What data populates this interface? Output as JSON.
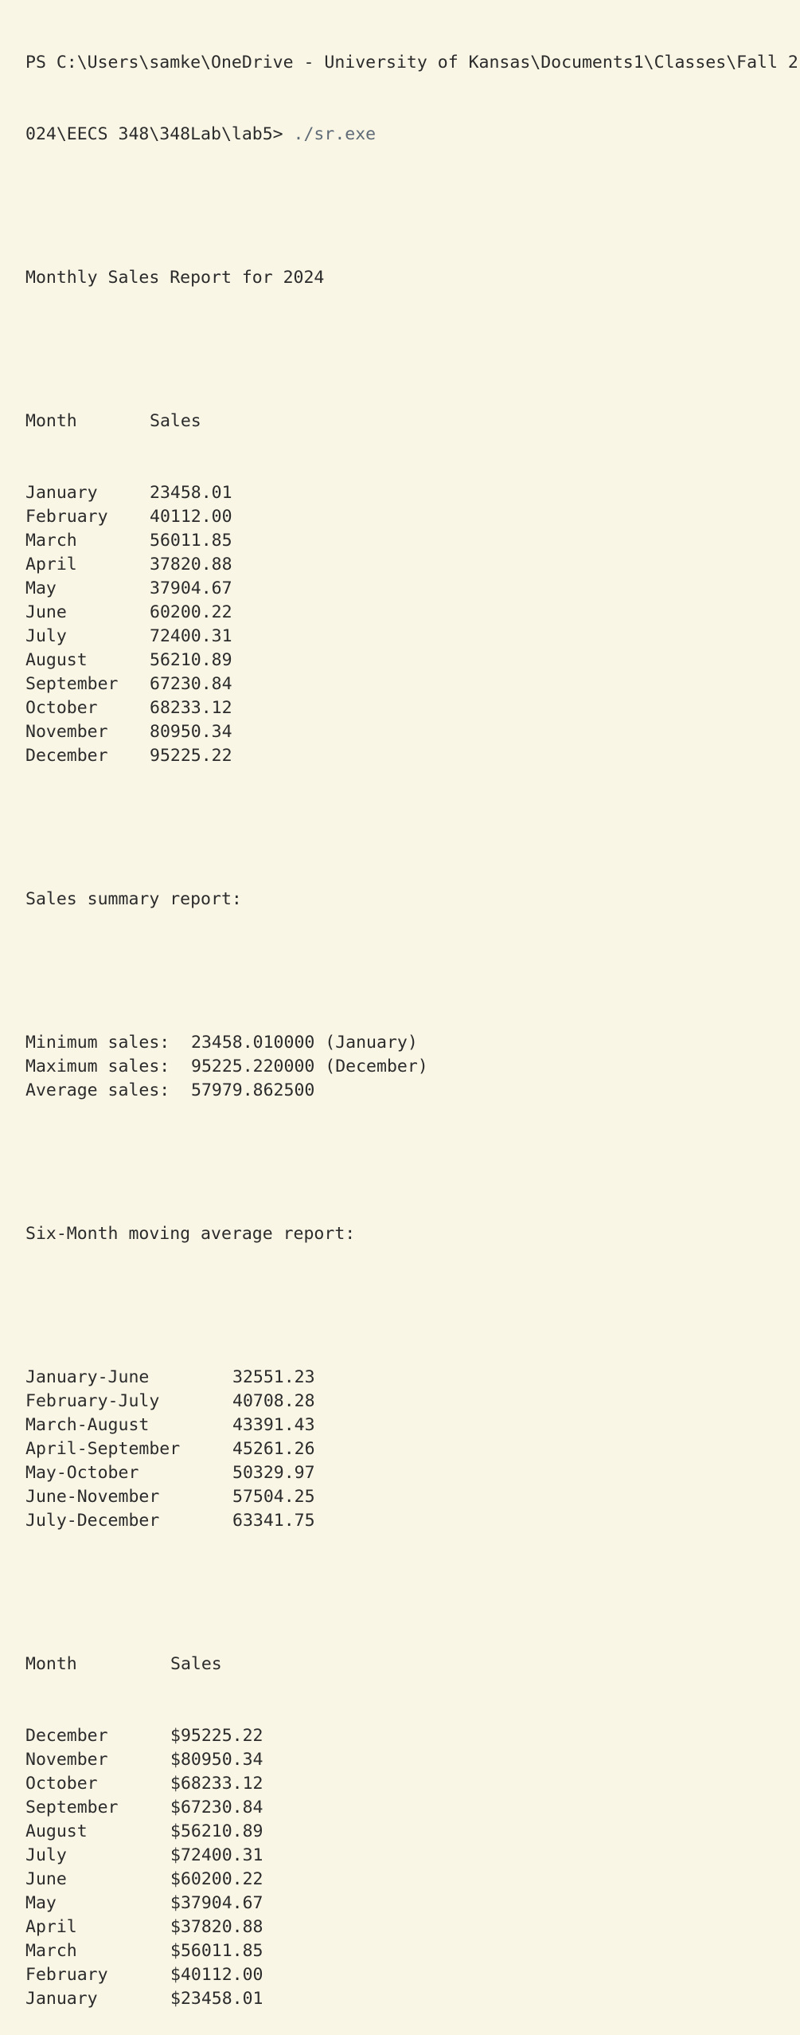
{
  "prompt": {
    "line1": "PS C:\\Users\\samke\\OneDrive - University of Kansas\\Documents1\\Classes\\Fall 2",
    "line2_prefix": "024\\EECS 348\\348Lab\\lab5> ",
    "command": "./sr.exe"
  },
  "report": {
    "title": "Monthly Sales Report for 2024",
    "header_month": "Month",
    "header_sales": "Sales",
    "rows": [
      {
        "month": "January",
        "sales": "23458.01"
      },
      {
        "month": "February",
        "sales": "40112.00"
      },
      {
        "month": "March",
        "sales": "56011.85"
      },
      {
        "month": "April",
        "sales": "37820.88"
      },
      {
        "month": "May",
        "sales": "37904.67"
      },
      {
        "month": "June",
        "sales": "60200.22"
      },
      {
        "month": "July",
        "sales": "72400.31"
      },
      {
        "month": "August",
        "sales": "56210.89"
      },
      {
        "month": "September",
        "sales": "67230.84"
      },
      {
        "month": "October",
        "sales": "68233.12"
      },
      {
        "month": "November",
        "sales": "80950.34"
      },
      {
        "month": "December",
        "sales": "95225.22"
      }
    ]
  },
  "summary": {
    "title": "Sales summary report:",
    "rows": [
      {
        "label": "Minimum sales:",
        "value": "23458.010000 (January)"
      },
      {
        "label": "Maximum sales:",
        "value": "95225.220000 (December)"
      },
      {
        "label": "Average sales:",
        "value": "57979.862500"
      }
    ]
  },
  "moving_average": {
    "title": "Six-Month moving average report:",
    "rows": [
      {
        "range": "January-June",
        "value": "32551.23"
      },
      {
        "range": "February-July",
        "value": "40708.28"
      },
      {
        "range": "March-August",
        "value": "43391.43"
      },
      {
        "range": "April-September",
        "value": "45261.26"
      },
      {
        "range": "May-October",
        "value": "50329.97"
      },
      {
        "range": "June-November",
        "value": "57504.25"
      },
      {
        "range": "July-December",
        "value": "63341.75"
      }
    ]
  },
  "sorted": {
    "header_month": "Month",
    "header_sales": "Sales",
    "rows": [
      {
        "month": "December",
        "sales": "$95225.22"
      },
      {
        "month": "November",
        "sales": "$80950.34"
      },
      {
        "month": "October",
        "sales": "$68233.12"
      },
      {
        "month": "September",
        "sales": "$67230.84"
      },
      {
        "month": "August",
        "sales": "$56210.89"
      },
      {
        "month": "July",
        "sales": "$72400.31"
      },
      {
        "month": "June",
        "sales": "$60200.22"
      },
      {
        "month": "May",
        "sales": "$37904.67"
      },
      {
        "month": "April",
        "sales": "$37820.88"
      },
      {
        "month": "March",
        "sales": "$56011.85"
      },
      {
        "month": "February",
        "sales": "$40112.00"
      },
      {
        "month": "January",
        "sales": "$23458.01"
      }
    ]
  }
}
